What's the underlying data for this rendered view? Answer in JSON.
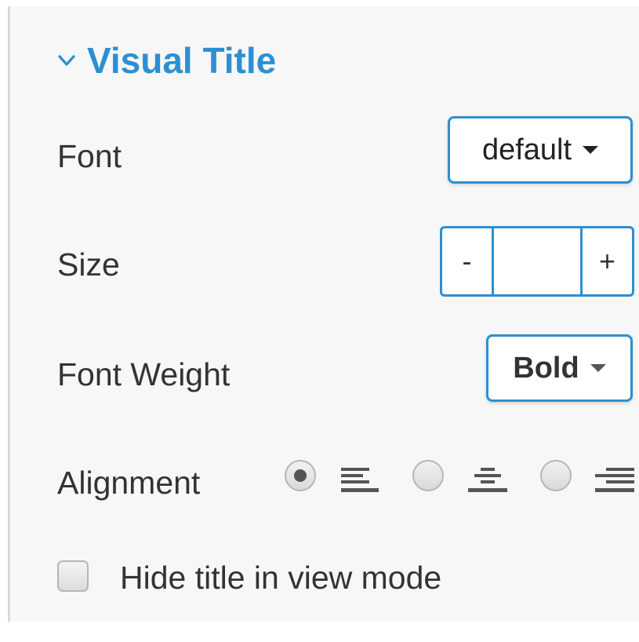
{
  "section": {
    "title": "Visual Title",
    "expanded": true,
    "accent_color": "#2d8fd1"
  },
  "font": {
    "label": "Font",
    "value": "default"
  },
  "size": {
    "label": "Size",
    "minus_label": "-",
    "plus_label": "+",
    "value": ""
  },
  "font_weight": {
    "label": "Font Weight",
    "value": "Bold"
  },
  "alignment": {
    "label": "Alignment",
    "options": [
      {
        "icon": "align-left-icon",
        "checked": true
      },
      {
        "icon": "align-center-icon",
        "checked": false
      },
      {
        "icon": "align-right-icon",
        "checked": false
      }
    ]
  },
  "hide_title": {
    "label": "Hide title in view mode",
    "checked": false
  }
}
